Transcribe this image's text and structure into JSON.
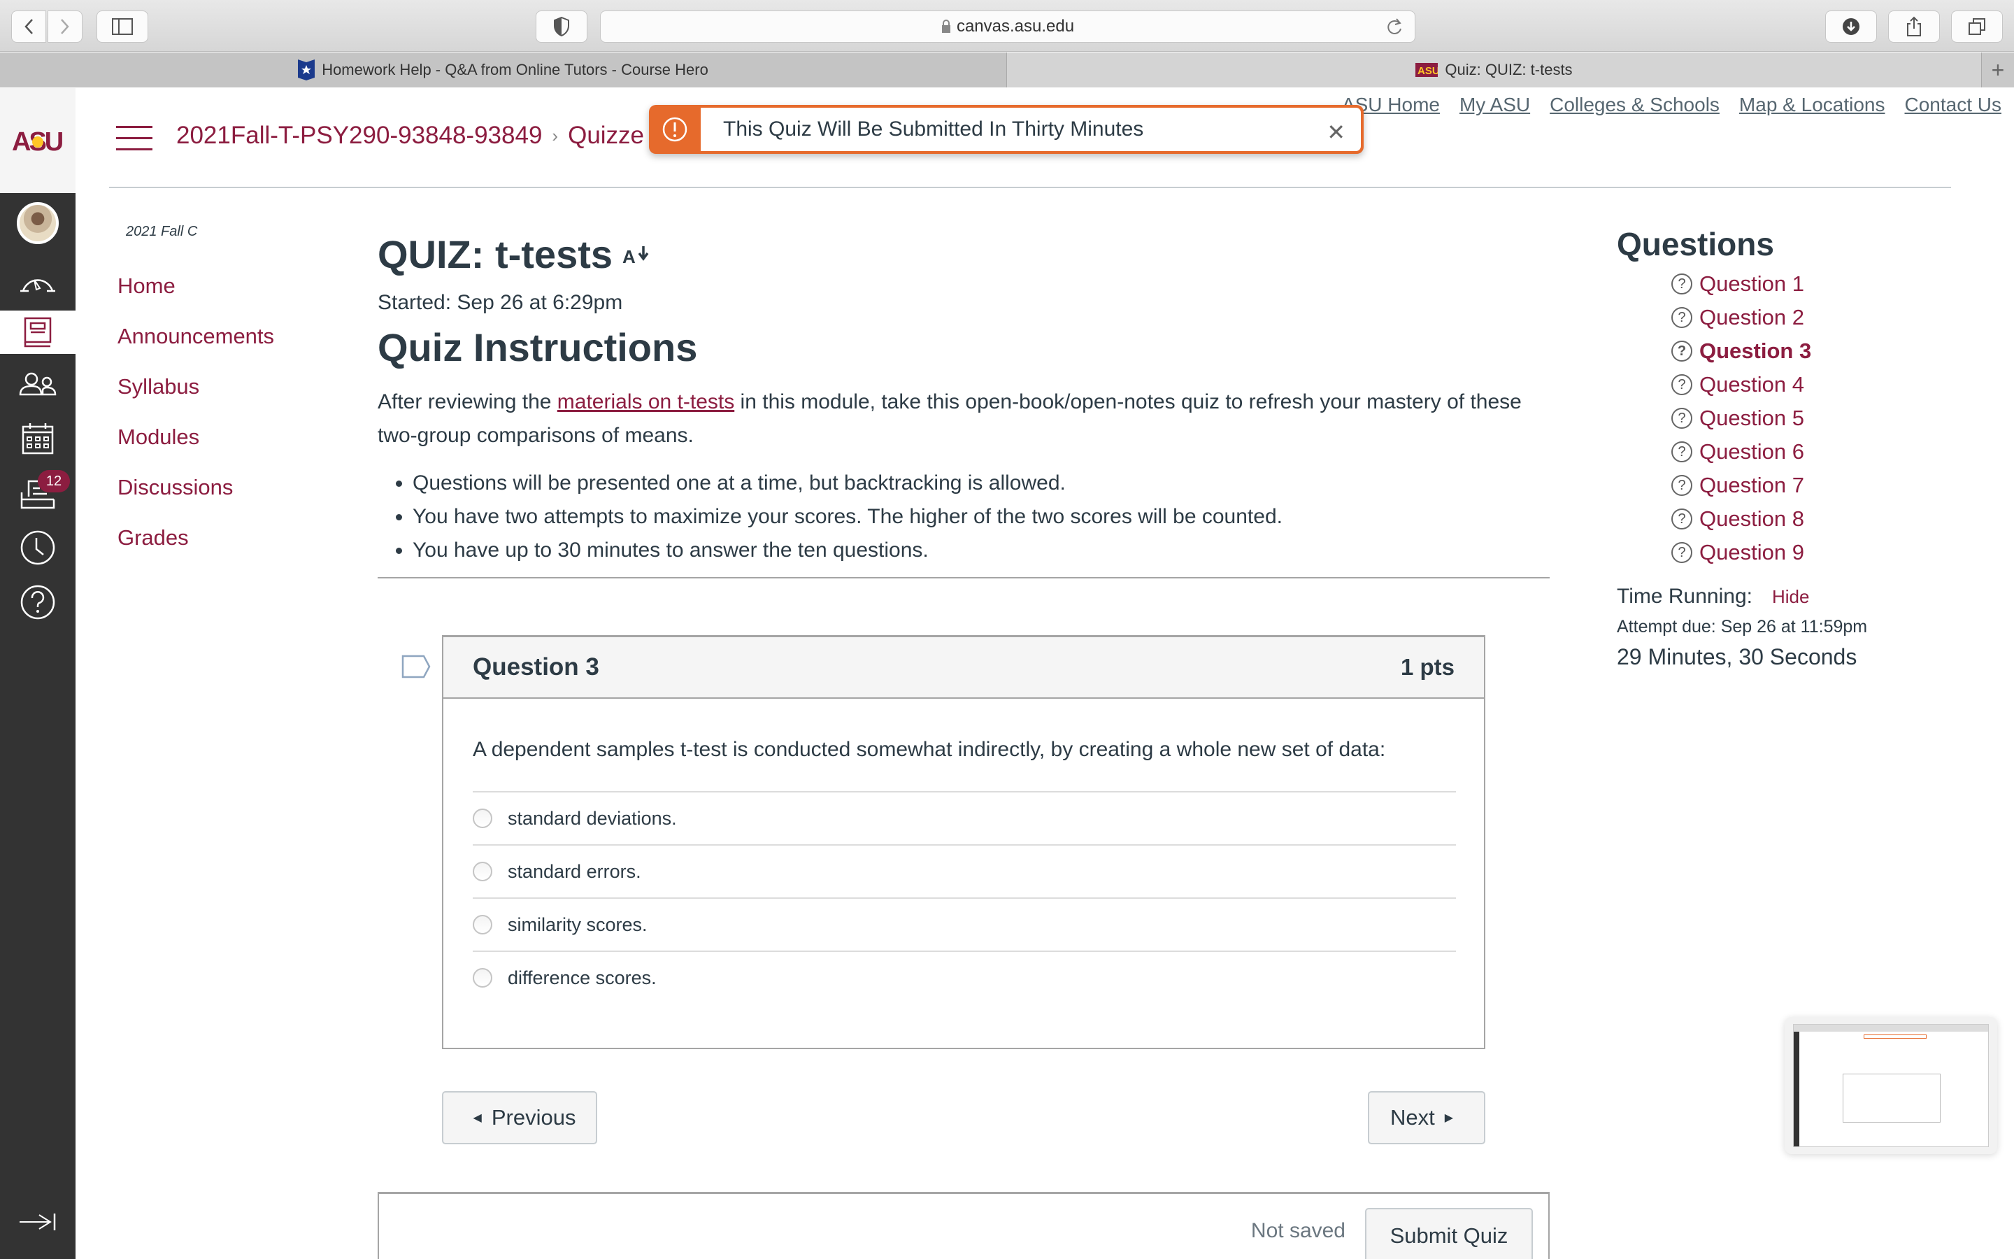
{
  "browser": {
    "url": "canvas.asu.edu",
    "tabs": [
      {
        "title": "Homework Help - Q&A from Online Tutors - Course Hero",
        "favicon": "course-hero-icon",
        "active": false
      },
      {
        "title": "Quiz: QUIZ: t-tests",
        "favicon": "asu-icon",
        "active": true
      }
    ],
    "new_tab": "+"
  },
  "global_nav": {
    "logo": "ASU",
    "items": [
      {
        "name": "account",
        "icon": "avatar"
      },
      {
        "name": "dashboard",
        "icon": "dashboard-icon"
      },
      {
        "name": "courses",
        "icon": "courses-icon",
        "active": true
      },
      {
        "name": "groups",
        "icon": "groups-icon"
      },
      {
        "name": "calendar",
        "icon": "calendar-icon"
      },
      {
        "name": "inbox",
        "icon": "inbox-icon",
        "badge": "12"
      },
      {
        "name": "history",
        "icon": "clock-icon"
      },
      {
        "name": "help",
        "icon": "help-icon"
      }
    ],
    "collapse_icon": "collapse-nav-icon"
  },
  "header": {
    "breadcrumb": [
      "2021Fall-T-PSY290-93848-93849",
      "Quizzes"
    ],
    "breadcrumb_visible": [
      "2021Fall-T-PSY290-93848-93849",
      "Quizze"
    ],
    "asu_links": [
      "ASU Home",
      "My ASU",
      "Colleges & Schools",
      "Map & Locations",
      "Contact Us"
    ]
  },
  "flash": {
    "message": "This Quiz Will Be Submitted In Thirty Minutes",
    "close": "✕",
    "color": "#e66a2c"
  },
  "course_nav": {
    "term": "2021 Fall C",
    "items": [
      "Home",
      "Announcements",
      "Syllabus",
      "Modules",
      "Discussions",
      "Grades"
    ]
  },
  "quiz": {
    "title": "QUIZ: t-tests",
    "started": "Started: Sep 26 at 6:29pm",
    "instructions_title": "Quiz Instructions",
    "intro_before": "After reviewing the ",
    "intro_link": "materials on t-tests",
    "intro_after": " in this module, take this open-book/open-notes quiz to refresh your mastery of these two-group comparisons of means.",
    "bullets": [
      "Questions will be presented one at a time, but backtracking is allowed.",
      "You have two attempts to maximize your scores.  The higher of the two scores will be counted.",
      "You have up to 30 minutes to answer the ten questions."
    ]
  },
  "question": {
    "name": "Question 3",
    "points": "1 pts",
    "text": "A dependent samples t-test is conducted somewhat indirectly, by creating a whole new set of data:",
    "answers": [
      "standard deviations.",
      "standard errors.",
      "similarity scores.",
      "difference scores."
    ],
    "selected": null
  },
  "navigation": {
    "previous": "Previous",
    "next": "Next",
    "save_status": "Not saved",
    "submit": "Submit Quiz"
  },
  "sidebar": {
    "title": "Questions",
    "questions": [
      "Question 1",
      "Question 2",
      "Question 3",
      "Question 4",
      "Question 5",
      "Question 6",
      "Question 7",
      "Question 8",
      "Question 9"
    ],
    "current": "Question 3",
    "timer_label": "Time Running:",
    "timer_toggle": "Hide",
    "attempt_due": "Attempt due: Sep 26 at 11:59pm",
    "time_remaining": "29 Minutes, 30 Seconds"
  },
  "colors": {
    "brand": "#8c1d40",
    "text": "#2d3b45",
    "alert": "#e66a2c",
    "nav_dark": "#333333"
  }
}
